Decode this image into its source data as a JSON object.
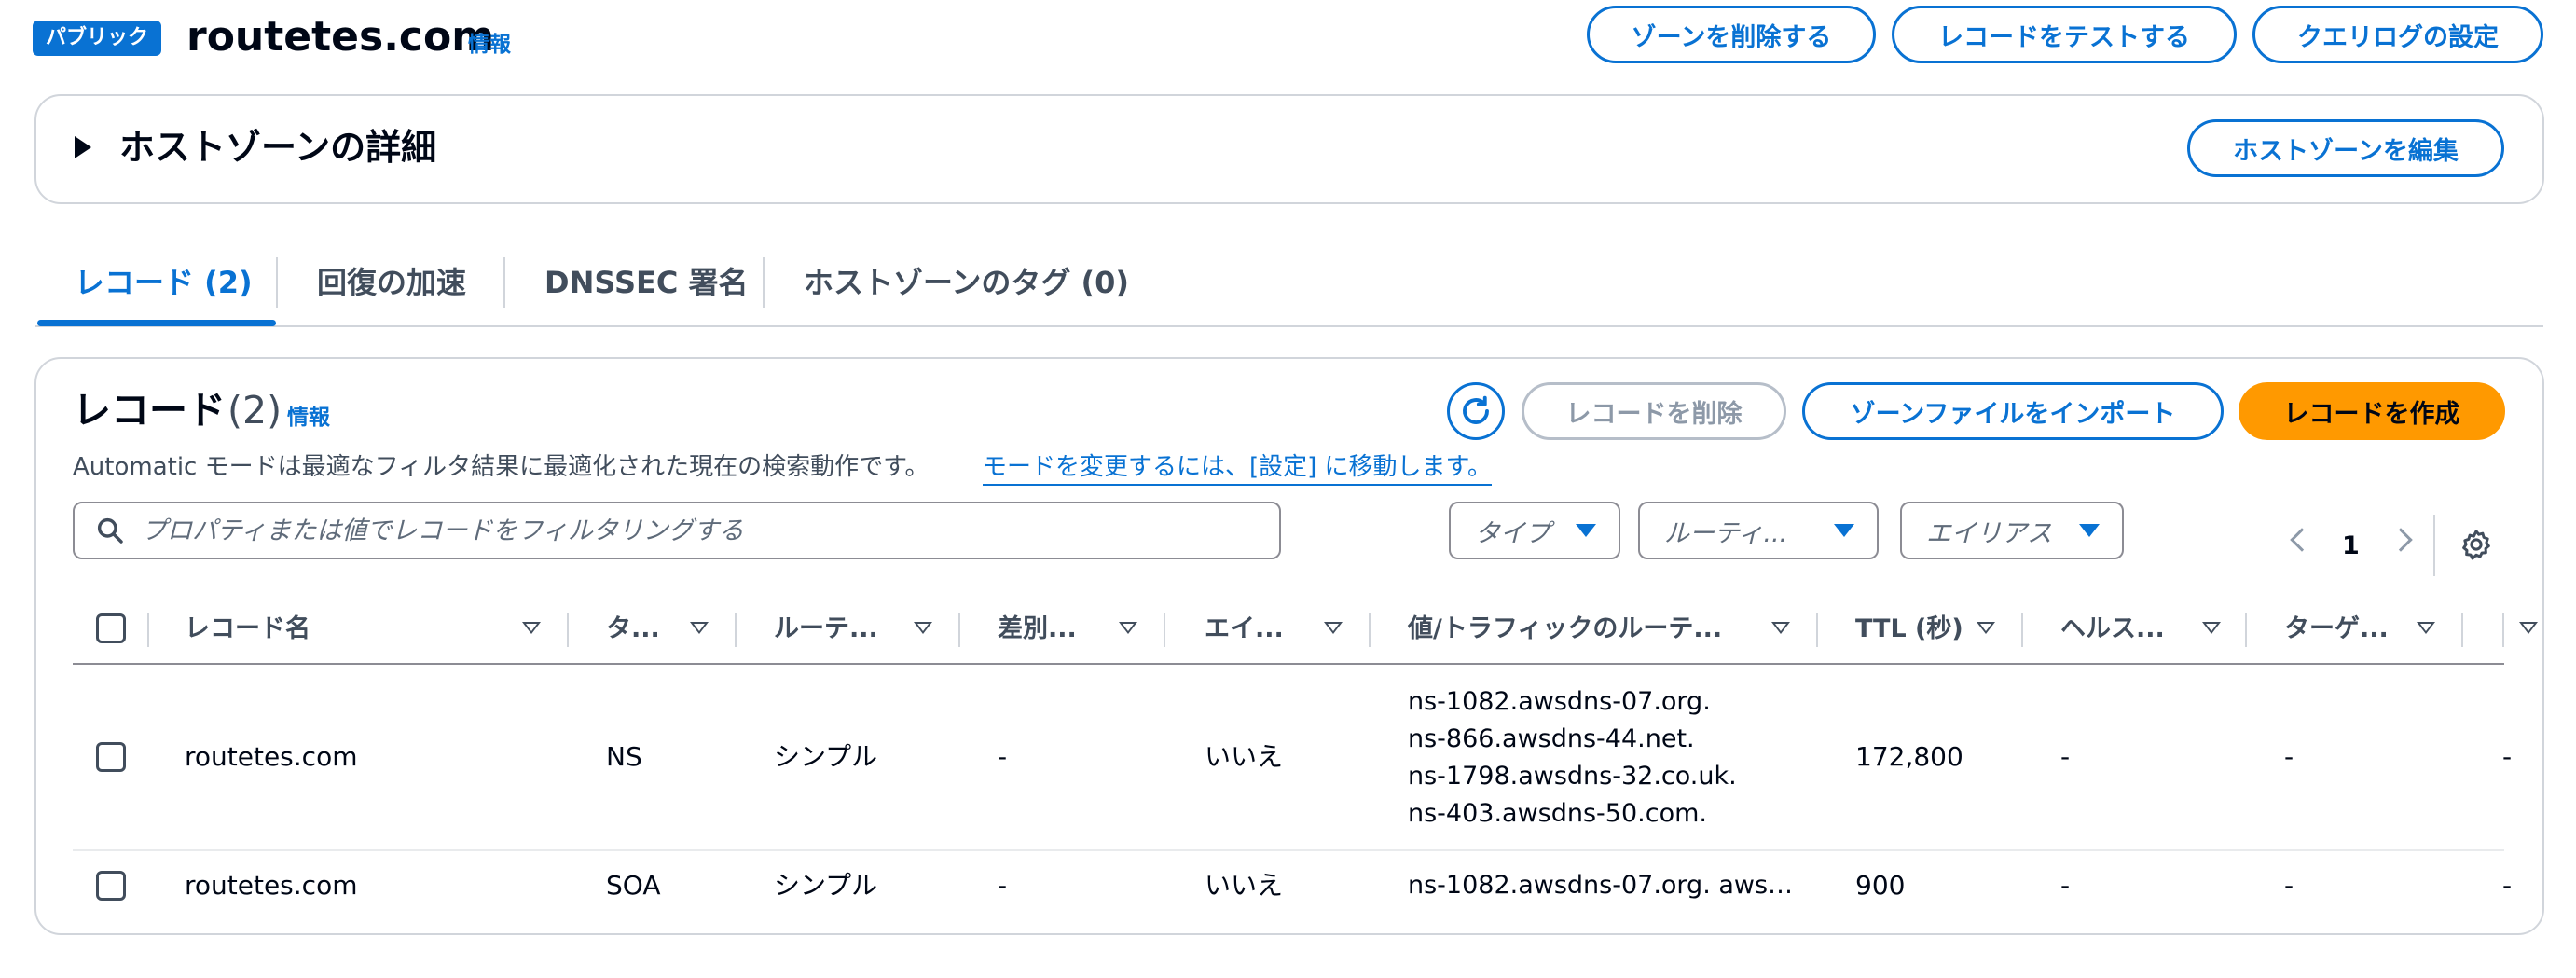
{
  "header": {
    "badge": "パブリック",
    "zone_name": "routetes.com",
    "info": "情報",
    "buttons": {
      "delete_zone": "ゾーンを削除する",
      "test_record": "レコードをテストする",
      "query_log": "クエリログの設定"
    }
  },
  "details": {
    "title": "ホストゾーンの詳細",
    "edit_button": "ホストゾーンを編集"
  },
  "tabs": [
    {
      "label": "レコード (2)",
      "active": true
    },
    {
      "label": "回復の加速"
    },
    {
      "label": "DNSSEC 署名"
    },
    {
      "label": "ホストゾーンのタグ (0)"
    }
  ],
  "records": {
    "title": "レコード",
    "count": "(2)",
    "info": "情報",
    "mode_text": "Automatic モードは最適なフィルタ結果に最適化された現在の検索動作です。",
    "mode_link": "モードを変更するには、[設定] に移動します。",
    "buttons": {
      "delete": "レコードを削除",
      "import": "ゾーンファイルをインポート",
      "create": "レコードを作成"
    },
    "search_placeholder": "プロパティまたは値でレコードをフィルタリングする",
    "filters": {
      "type": "タイプ",
      "routing": "ルーティ...",
      "alias": "エイリアス"
    },
    "page": "1",
    "columns": {
      "name": "レコード名",
      "type": "タ...",
      "routing": "ルーテ...",
      "diff": "差別...",
      "alias": "エイ...",
      "value": "値/トラフィックのルーテ...",
      "ttl": "TTL (秒)",
      "health": "ヘルス...",
      "target": "ターゲ..."
    },
    "rows": [
      {
        "name": "routetes.com",
        "type": "NS",
        "routing": "シンプル",
        "diff": "-",
        "alias": "いいえ",
        "values": [
          "ns-1082.awsdns-07.org.",
          "ns-866.awsdns-44.net.",
          "ns-1798.awsdns-32.co.uk.",
          "ns-403.awsdns-50.com."
        ],
        "ttl": "172,800",
        "health": "-",
        "target": "-",
        "extra": "-"
      },
      {
        "name": "routetes.com",
        "type": "SOA",
        "routing": "シンプル",
        "diff": "-",
        "alias": "いいえ",
        "value": "ns-1082.awsdns-07.org. aws…",
        "ttl": "900",
        "health": "-",
        "target": "-",
        "extra": "-"
      }
    ]
  },
  "colors": {
    "accent": "#0972d3",
    "primary_button": "#ff9900",
    "border": "#d1d5db"
  },
  "icons": [
    "search-icon",
    "refresh-icon",
    "settings-icon",
    "chevron-left-icon",
    "chevron-right-icon",
    "caret-right-icon",
    "caret-down-icon"
  ]
}
